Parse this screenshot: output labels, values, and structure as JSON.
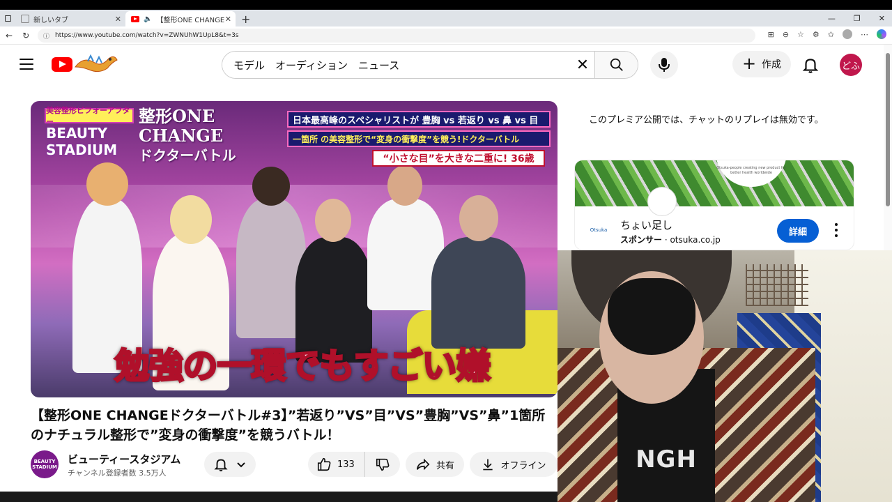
{
  "browser": {
    "tabs": [
      {
        "label": "新しいタブ"
      },
      {
        "label": "【整形ONE CHANGEドクターバト"
      }
    ],
    "url": "https://www.youtube.com/watch?v=ZWNUhW1UpL8&t=3s"
  },
  "header": {
    "search_value": "モデル　オーディション　ニュース",
    "create_label": "作成",
    "avatar_text": "どふ"
  },
  "video": {
    "badge": "美容整形ビフォーアフター",
    "logo_line1": "BEAUTY",
    "logo_line2": "STADIUM",
    "show_title_line1": "整形ONE CHANGE",
    "show_title_line2": "ドクターバトル",
    "banner1": "日本最高峰のスペシャリストが 豊胸 vs 若返り vs 鼻 vs 目",
    "banner2": "一箇所 の美容整形で“変身の衝撃度”を競う!ドクターバトル",
    "banner3": "“小さな目”を大きな二重に! 36歳",
    "caption": "勉強の一環でもすごい嫌"
  },
  "title": "【整形ONE CHANGEドクターバトル#3】”若返り”VS”目”VS”豊胸”VS”鼻”1箇所のナチュラル整形で”変身の衝撃度”を競うバトル！",
  "channel": {
    "avatar_line1": "BEAUTY",
    "avatar_line2": "STADIUM",
    "name": "ビューティースタジアム",
    "subscribers": "チャンネル登録者数 3.5万人"
  },
  "actions": {
    "likes": "133",
    "share": "共有",
    "offline": "オフライン"
  },
  "sidebar": {
    "chat_note": "このプレミア公開では、チャットのリプレイは無効です。",
    "ad": {
      "title": "ちょい足し",
      "sponsor_label": "スポンサー",
      "sponsor_domain": "otsuka.co.jp",
      "detail_label": "詳細",
      "banner_text": "Otsuka-people creating new product for better health worldwide",
      "logo_text": "Otsuka"
    }
  },
  "webcam": {
    "shirt_text": "NGH"
  }
}
